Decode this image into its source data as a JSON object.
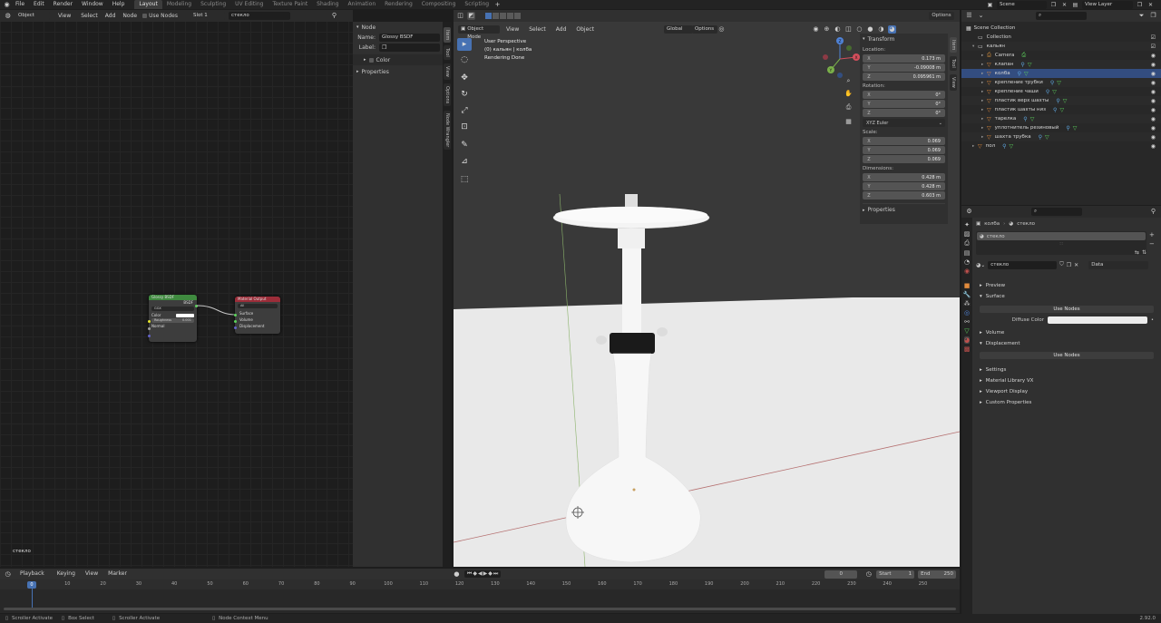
{
  "topbar": {
    "menus": [
      "File",
      "Edit",
      "Render",
      "Window",
      "Help"
    ],
    "workspaces": [
      "Layout",
      "Modeling",
      "Sculpting",
      "UV Editing",
      "Texture Paint",
      "Shading",
      "Animation",
      "Rendering",
      "Compositing",
      "Scripting"
    ],
    "active_workspace": "Layout",
    "scene": "Scene",
    "view_layer": "View Layer"
  },
  "node_editor": {
    "mode": "Object",
    "menus": [
      "View",
      "Select",
      "Add",
      "Node"
    ],
    "use_nodes": "Use Nodes",
    "slot": "Slot 1",
    "material": "стекло",
    "material_label": "стекло",
    "glossy": {
      "title": "Glossy BSDF",
      "output": "BSDF",
      "distribution": "GGX",
      "color_label": "Color",
      "roughness_label": "Roughness",
      "roughness_value": "0.001",
      "normal_label": "Normal"
    },
    "output": {
      "title": "Material Output",
      "target": "All",
      "surface": "Surface",
      "volume": "Volume",
      "displacement": "Displacement"
    }
  },
  "node_sidebar": {
    "section": "Node",
    "name_label": "Name:",
    "name_value": "Glossy BSDF",
    "label_label": "Label:",
    "color_label": "Color",
    "properties_label": "Properties",
    "tabs": [
      "Item",
      "Tool",
      "View",
      "Options",
      "Node Wrangler"
    ]
  },
  "viewport": {
    "mode": "Object Mode",
    "menus": [
      "View",
      "Select",
      "Add",
      "Object"
    ],
    "orientation": "Global",
    "options": "Options",
    "info_lines": [
      "User Perspective",
      "(0) кальян | колба",
      "Rendering Done"
    ],
    "gizmo_axes": [
      "Z",
      "Y",
      "X"
    ]
  },
  "transform": {
    "title": "Transform",
    "location_label": "Location:",
    "location": {
      "x": "0.173 m",
      "y": "-0.09008 m",
      "z": "0.095961 m"
    },
    "rotation_label": "Rotation:",
    "rotation": {
      "x": "0°",
      "y": "0°",
      "z": "0°"
    },
    "rotation_mode": "XYZ Euler",
    "scale_label": "Scale:",
    "scale": {
      "x": "0.069",
      "y": "0.069",
      "z": "0.069"
    },
    "dimensions_label": "Dimensions:",
    "dimensions": {
      "x": "0.428 m",
      "y": "0.428 m",
      "z": "0.603 m"
    },
    "properties_label": "Properties",
    "axis_labels": [
      "X",
      "Y",
      "Z"
    ],
    "tabs": [
      "Item",
      "Tool",
      "View"
    ]
  },
  "outliner": {
    "root": "Scene Collection",
    "items": [
      {
        "name": "Collection",
        "level": 0,
        "type": "collection"
      },
      {
        "name": "кальян",
        "level": 0,
        "type": "collection"
      },
      {
        "name": "Camera",
        "level": 1,
        "type": "camera"
      },
      {
        "name": "клапан",
        "level": 1,
        "type": "mesh"
      },
      {
        "name": "колба",
        "level": 1,
        "type": "mesh",
        "selected": true
      },
      {
        "name": "крепление трубки",
        "level": 1,
        "type": "mesh"
      },
      {
        "name": "крепление чаши",
        "level": 1,
        "type": "mesh"
      },
      {
        "name": "пластик верх шахты",
        "level": 1,
        "type": "mesh"
      },
      {
        "name": "пластик шахты низ",
        "level": 1,
        "type": "mesh"
      },
      {
        "name": "тарелка",
        "level": 1,
        "type": "mesh"
      },
      {
        "name": "уплотнитель резиновый",
        "level": 1,
        "type": "mesh"
      },
      {
        "name": "шахта трубка",
        "level": 1,
        "type": "mesh"
      },
      {
        "name": "пол",
        "level": 0,
        "type": "mesh"
      }
    ]
  },
  "properties": {
    "breadcrumb_object": "колба",
    "breadcrumb_material": "стекло",
    "slot_name": "стекло",
    "material_name": "стекло",
    "link": "Data",
    "sections": {
      "preview": "Preview",
      "surface": "Surface",
      "volume": "Volume",
      "displacement": "Displacement",
      "settings": "Settings",
      "material_library": "Material Library VX",
      "viewport_display": "Viewport Display",
      "custom_properties": "Custom Properties"
    },
    "use_nodes": "Use Nodes",
    "diffuse_label": "Diffuse Color"
  },
  "timeline": {
    "menus": [
      "Playback",
      "Keying",
      "View",
      "Marker"
    ],
    "current_frame": "0",
    "start_label": "Start",
    "start": "1",
    "end_label": "End",
    "end": "250",
    "ruler": [
      "0",
      "10",
      "20",
      "30",
      "40",
      "50",
      "60",
      "70",
      "80",
      "90",
      "100",
      "110",
      "120",
      "130",
      "140",
      "150",
      "160",
      "170",
      "180",
      "190",
      "200",
      "210",
      "220",
      "230",
      "240",
      "250"
    ]
  },
  "statusbar": {
    "items": [
      "Scroller Activate",
      "Box Select",
      "Scroller Activate",
      "Node Context Menu"
    ],
    "version": "2.92.0"
  },
  "colors": {
    "accent": "#4772b3",
    "glossy_header": "#3f8a3f",
    "output_header": "#9c2d39",
    "selected_row": "#334d80",
    "floor": "#e9e9e9",
    "object": "#f4f4f4"
  }
}
